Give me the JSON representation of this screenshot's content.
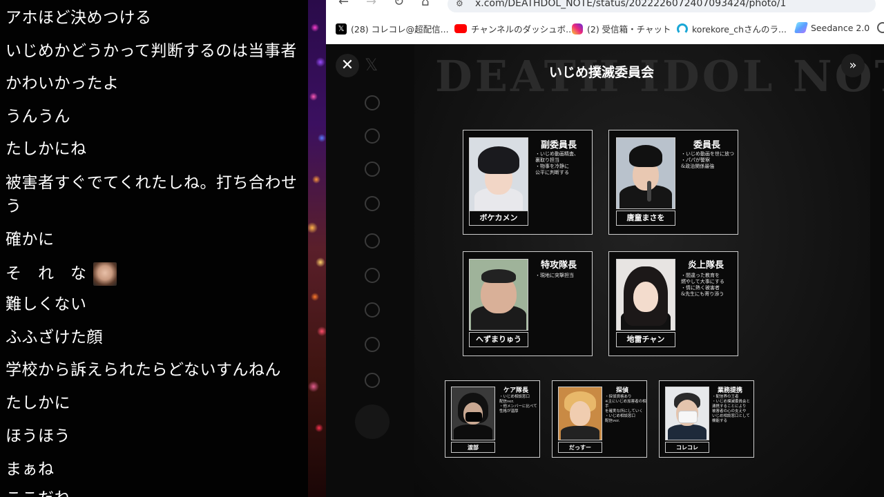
{
  "chat": {
    "messages": [
      "アホほど決めつける",
      "いじめかどうかって判断するのは当事者",
      "かわいかったよ",
      "うんうん",
      "たしかにね",
      "被害者すぐでてくれたしね。打ち合わせ",
      "う",
      "確かに",
      "そ　れ　な",
      "難しくない",
      "ふふざけた顔",
      "学校から訴えられたらどないすんねん",
      "たしかに",
      "ほうほう",
      "まぁね",
      "ここだね"
    ]
  },
  "browser": {
    "url": "x.com/DEATHDOL_NOTE/status/2022226072407093424/photo/1",
    "bookmarks": [
      {
        "label": "(28) コレコレ@超配信...",
        "icon": "x-icon",
        "color": "#000000"
      },
      {
        "label": "チャンネルのダッシュボ...",
        "icon": "youtube-icon",
        "color": "#ff0000"
      },
      {
        "label": "(2) 受信箱・チャット",
        "icon": "instagram-icon",
        "color": "#d62976"
      },
      {
        "label": "korekore_chさんのラ...",
        "icon": "headset-icon",
        "color": "#1aa7d6"
      },
      {
        "label": "Seedance 2.0",
        "icon": "seedance-icon",
        "color": "#5aa0ff"
      }
    ]
  },
  "poster": {
    "title_bg": "DEATH IDOL NOTE",
    "committee": "いじめ撲滅委員会",
    "members": [
      {
        "role": "副委員長",
        "desc": "・いじめ動画精査、\n裏取り担当\n・物事を冷静に\n公平に判断する",
        "name": "ボケカメン"
      },
      {
        "role": "委員長",
        "desc": "・いじめ動画を世に放つ\n・パパが警察\n&政治関係最強",
        "name": "唐童まさを"
      },
      {
        "role": "特攻隊長",
        "desc": "・現地に突撃担当",
        "name": "へずまりゅう"
      },
      {
        "role": "炎上隊長",
        "desc": "・間違った教育を\n燃やして大事にする\n・情に熱く被害者\n&先生にも寄り添う",
        "name": "地雷チャン"
      },
      {
        "role": "ケア隊長",
        "desc": "・いじめ相談窓口\n配信ver.\n・他メンバーに比べて\n性格が温厚",
        "name": "渡部"
      },
      {
        "role": "探偵",
        "desc": "・探偵資格あり\n※主にいじめ加害者の相手\nを確実な所にしていく\n・いじめ相談窓口\n配信ver.",
        "name": "だっすー"
      },
      {
        "role": "業務提携",
        "desc": "・配信界の王者\n・いじめ撲滅委員会と\n連携することにより\n被害者の心の支えや\nいじめ相談窓口として\n機能する",
        "name": "コレコレ"
      }
    ]
  }
}
